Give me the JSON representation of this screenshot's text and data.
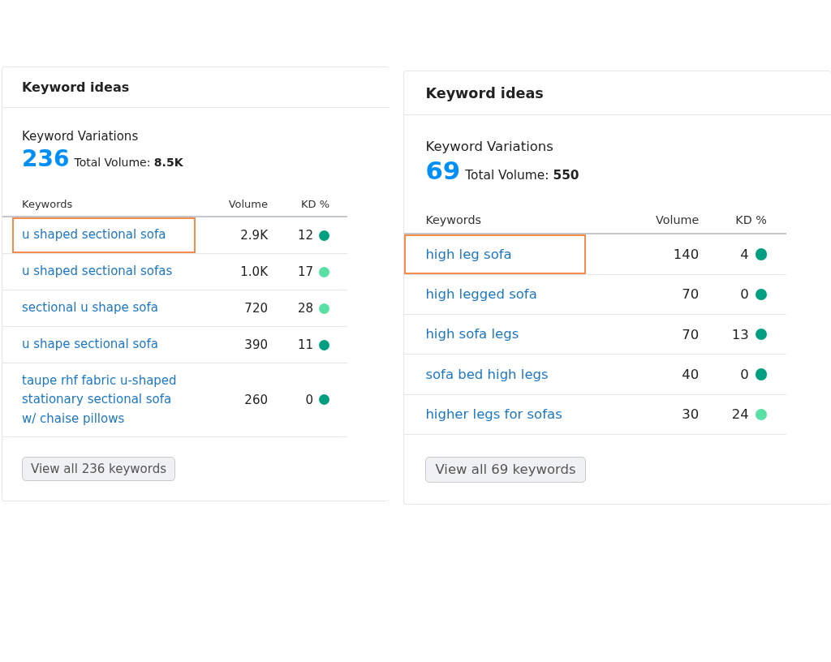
{
  "cards": [
    {
      "title": "Keyword ideas",
      "subtitle": "Keyword Variations",
      "count": "236",
      "total_label": "Total Volume:",
      "total_value": "8.5K",
      "columns": [
        "Keywords",
        "Volume",
        "KD %"
      ],
      "rows": [
        {
          "keyword": "u shaped sectional sofa",
          "volume": "2.9K",
          "kd": "12",
          "color": "#009f81",
          "highlighted": true
        },
        {
          "keyword": "u shaped sectional sofas",
          "volume": "1.0K",
          "kd": "17",
          "color": "#59e0a5",
          "highlighted": false
        },
        {
          "keyword": "sectional u shape sofa",
          "volume": "720",
          "kd": "28",
          "color": "#59e0a5",
          "highlighted": false
        },
        {
          "keyword": "u shape sectional sofa",
          "volume": "390",
          "kd": "11",
          "color": "#009f81",
          "highlighted": false
        },
        {
          "keyword": "taupe rhf fabric u-shaped stationary sectional sofa w/ chaise pillows",
          "volume": "260",
          "kd": "0",
          "color": "#009f81",
          "highlighted": false
        }
      ],
      "button": "View all 236 keywords"
    },
    {
      "title": "Keyword ideas",
      "subtitle": "Keyword Variations",
      "count": "69",
      "total_label": "Total Volume:",
      "total_value": "550",
      "columns": [
        "Keywords",
        "Volume",
        "KD %"
      ],
      "rows": [
        {
          "keyword": "high leg sofa",
          "volume": "140",
          "kd": "4",
          "color": "#009f81",
          "highlighted": true
        },
        {
          "keyword": "high legged sofa",
          "volume": "70",
          "kd": "0",
          "color": "#009f81",
          "highlighted": false
        },
        {
          "keyword": "high sofa legs",
          "volume": "70",
          "kd": "13",
          "color": "#009f81",
          "highlighted": false
        },
        {
          "keyword": "sofa bed high legs",
          "volume": "40",
          "kd": "0",
          "color": "#009f81",
          "highlighted": false
        },
        {
          "keyword": "higher legs for sofas",
          "volume": "30",
          "kd": "24",
          "color": "#59e0a5",
          "highlighted": false
        }
      ],
      "button": "View all 69 keywords"
    }
  ]
}
